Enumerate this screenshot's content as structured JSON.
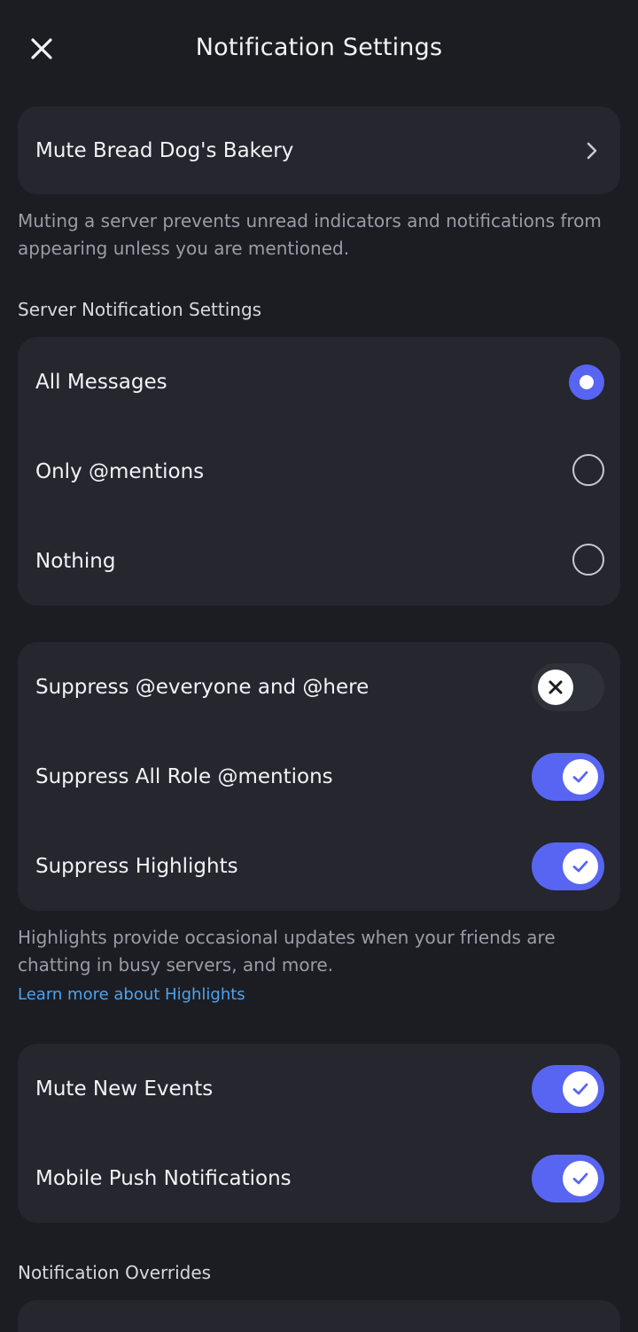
{
  "header": {
    "title": "Notification Settings",
    "close_icon": "close-icon"
  },
  "mute": {
    "label": "Mute Bread Dog's Bakery",
    "icon": "chevron-right-icon",
    "help": "Muting a server prevents unread indicators and notifications from appearing unless you are mentioned."
  },
  "server_notifications": {
    "header": "Server Notification Settings",
    "options": [
      {
        "label": "All Messages",
        "selected": true
      },
      {
        "label": "Only @mentions",
        "selected": false
      },
      {
        "label": "Nothing",
        "selected": false
      }
    ]
  },
  "suppress": {
    "items": [
      {
        "label": "Suppress @everyone and @here",
        "on": false
      },
      {
        "label": "Suppress All Role @mentions",
        "on": true
      },
      {
        "label": "Suppress Highlights",
        "on": true
      }
    ],
    "help": "Highlights provide occasional updates when your friends are chatting in busy servers, and more.",
    "link": "Learn more about Highlights"
  },
  "other": {
    "items": [
      {
        "label": "Mute New Events",
        "on": true
      },
      {
        "label": "Mobile Push Notifications",
        "on": true
      }
    ]
  },
  "overrides": {
    "header": "Notification Overrides"
  },
  "colors": {
    "background": "#1c1d23",
    "card": "#25262e",
    "accent": "#5865f2",
    "link": "#4ea3ee",
    "muted_text": "#9a9ca6"
  }
}
